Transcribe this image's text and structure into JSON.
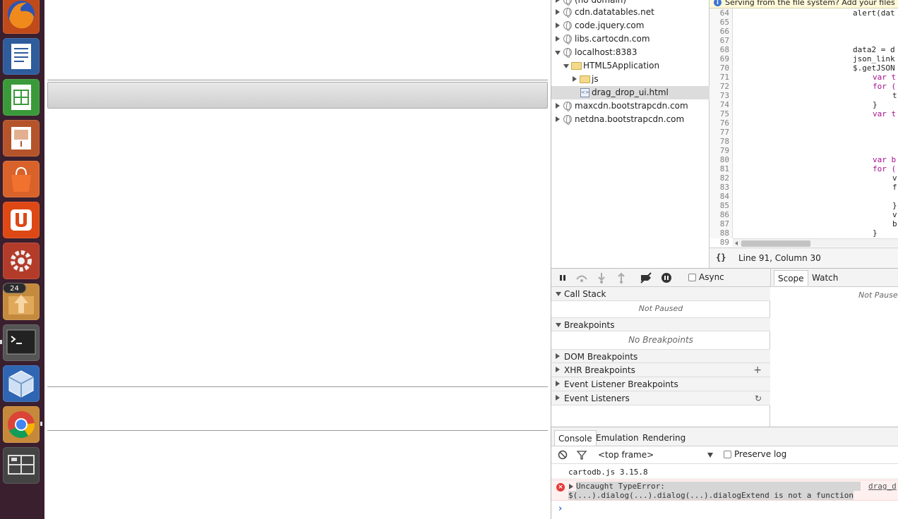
{
  "launcher": {
    "badge_count": "24",
    "apps": [
      {
        "name": "firefox-icon"
      },
      {
        "name": "libreoffice-writer-icon"
      },
      {
        "name": "libreoffice-calc-icon"
      },
      {
        "name": "libreoffice-impress-icon"
      },
      {
        "name": "software-center-icon"
      },
      {
        "name": "ubuntu-one-icon"
      },
      {
        "name": "system-settings-icon"
      },
      {
        "name": "update-manager-icon"
      },
      {
        "name": "terminal-icon"
      },
      {
        "name": "virtualbox-icon"
      },
      {
        "name": "chrome-icon"
      },
      {
        "name": "workspace-switcher-icon"
      }
    ]
  },
  "navigator": {
    "items": [
      {
        "label": "(no domain)"
      },
      {
        "label": "cdn.datatables.net"
      },
      {
        "label": "code.jquery.com"
      },
      {
        "label": "libs.cartocdn.com"
      },
      {
        "label": "localhost:8383"
      },
      {
        "label": "HTML5Application"
      },
      {
        "label": "js"
      },
      {
        "label": "drag_drop_ui.html"
      },
      {
        "label": "maxcdn.bootstrapcdn.com"
      },
      {
        "label": "netdna.bootstrapcdn.com"
      }
    ]
  },
  "editor": {
    "infobar": "Serving from the file system? Add your files in",
    "line_numbers": [
      "64",
      "65",
      "66",
      "67",
      "68",
      "69",
      "70",
      "71",
      "72",
      "73",
      "74",
      "75",
      "76",
      "77",
      "78",
      "79",
      "80",
      "81",
      "82",
      "83",
      "84",
      "85",
      "86",
      "87",
      "88",
      "89"
    ],
    "lines": [
      "alert(dat",
      "",
      "",
      "",
      "data2 = d",
      "json_link",
      "$.getJSON",
      "var t",
      "for (",
      "t",
      "}",
      "var t",
      "",
      "",
      "",
      "",
      "var b",
      "for (",
      "v",
      "f",
      "",
      "}",
      "v",
      "b",
      "}",
      ""
    ],
    "pretty_print": "{}",
    "cursor_position": "Line 91, Column 30"
  },
  "debugger": {
    "async_label": "Async",
    "tabs": {
      "scope": "Scope",
      "watch": "Watch"
    },
    "scope_state": "Not Paused",
    "panes": {
      "call_stack": "Call Stack",
      "call_stack_state": "Not Paused",
      "breakpoints": "Breakpoints",
      "breakpoints_state": "No Breakpoints",
      "dom_breakpoints": "DOM Breakpoints",
      "xhr_breakpoints": "XHR Breakpoints",
      "event_listener_breakpoints": "Event Listener Breakpoints",
      "event_listeners": "Event Listeners"
    }
  },
  "drawer": {
    "tabs": {
      "console": "Console",
      "emulation": "Emulation",
      "rendering": "Rendering"
    },
    "frame": "<top frame>",
    "preserve_log": "Preserve log",
    "log_message": "cartodb.js 3.15.8",
    "error_line1": "Uncaught TypeError:",
    "error_line2": "$(...).dialog(...).dialog(...).dialogExtend is not a function",
    "error_source": "drag_d",
    "prompt": "›"
  },
  "colors": {
    "launcher_bg": "#3a1f2e",
    "error_bg": "#fff0f0",
    "keyword": "#aa0d91"
  }
}
